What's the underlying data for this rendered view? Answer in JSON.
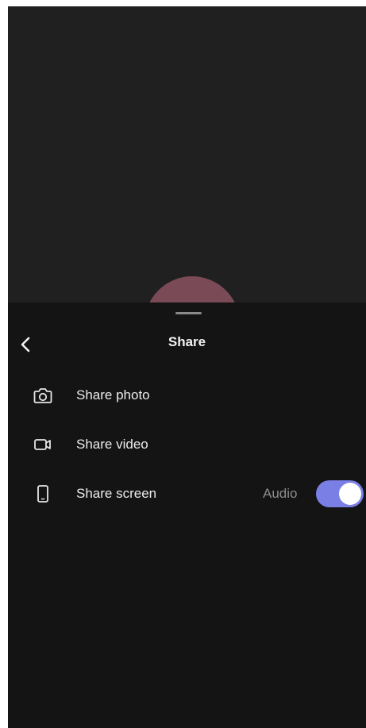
{
  "sheet": {
    "title": "Share",
    "options": [
      {
        "label": "Share photo",
        "icon": "camera-icon"
      },
      {
        "label": "Share video",
        "icon": "video-camera-icon"
      },
      {
        "label": "Share screen",
        "icon": "phone-screen-icon"
      }
    ],
    "audio": {
      "label": "Audio",
      "enabled": true
    }
  },
  "colors": {
    "video_background": "#202020",
    "sheet_background": "#141414",
    "avatar": "#7a4a57",
    "toggle_on": "#7a7fe6"
  }
}
